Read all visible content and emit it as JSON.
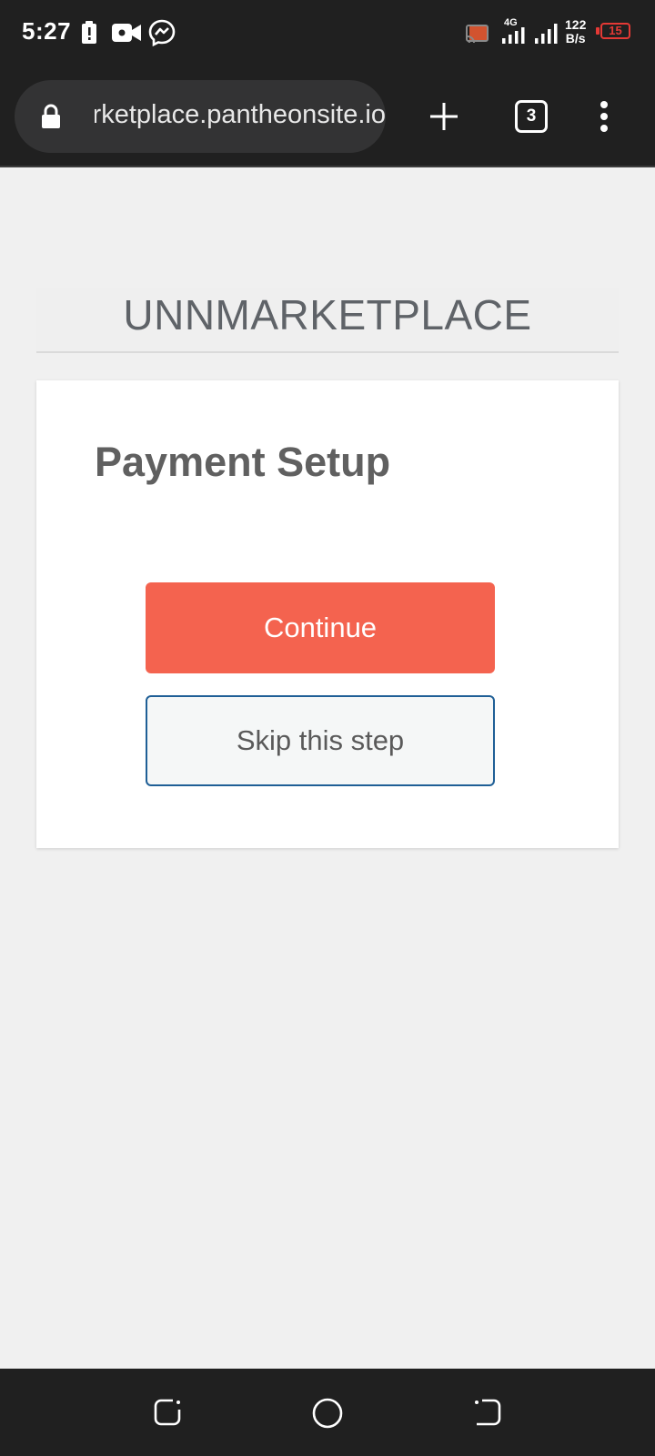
{
  "status_bar": {
    "time": "5:27",
    "network_type": "4G",
    "net_speed_value": "122",
    "net_speed_unit": "B/s",
    "battery_level": "15",
    "icons": [
      "battery-saver-icon",
      "video-recording-icon",
      "messenger-icon",
      "cast-icon",
      "signal-icon",
      "signal-icon",
      "battery-icon"
    ],
    "battery_color": "#e53935"
  },
  "browser": {
    "url": "unnmarketplace.pantheonsite.io",
    "tab_count": "3",
    "icons": [
      "lock-icon",
      "new-tab-plus-icon",
      "tab-switcher-icon",
      "more-menu-icon"
    ]
  },
  "page": {
    "site_title": "UNNMARKETPLACE",
    "card": {
      "title": "Payment Setup",
      "continue_label": "Continue",
      "skip_label": "Skip this step"
    },
    "colors": {
      "continue_bg": "#f4634f",
      "skip_border": "#1f5f96"
    }
  },
  "nav_bar": {
    "icons": [
      "recent-apps-icon",
      "home-icon",
      "back-icon"
    ]
  }
}
